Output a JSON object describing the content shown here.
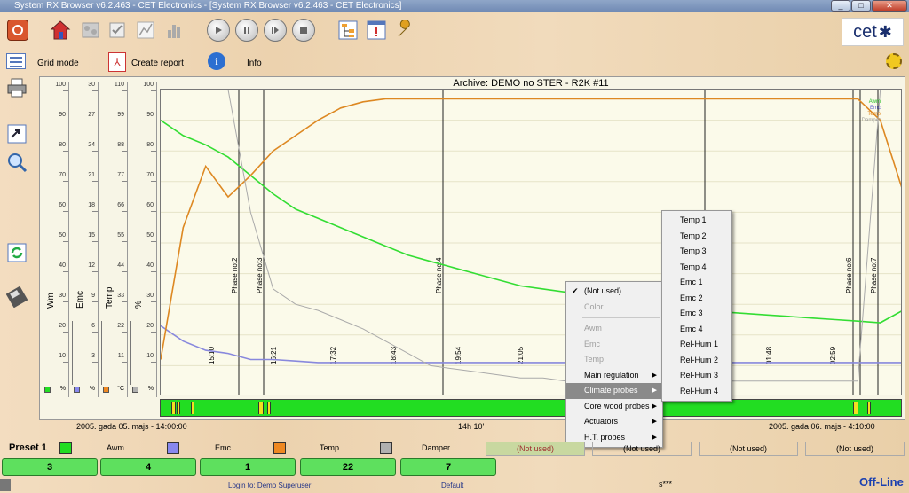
{
  "window": {
    "title": "System RX Browser v6.2.463 - CET Electronics - [System RX Browser v6.2.463 - CET Electronics]",
    "min": "_",
    "max": "□",
    "close": "✕"
  },
  "brand": {
    "logo_text": "cet"
  },
  "menu": {
    "grid_mode": "Grid mode",
    "create_report": "Create report",
    "info": "Info"
  },
  "chart": {
    "title": "Archive: DEMO no STER  -  R2K #11",
    "date_left": "2005. gada 05. majs  -  14:00:00",
    "duration": "14h 10'",
    "date_right": "2005. gada 06. majs  -  4:10:00",
    "time_ticks": [
      "15:10",
      "16:21",
      "17:32",
      "18:43",
      "19:54",
      "21:05",
      "01:48",
      "02:59"
    ],
    "phase_labels": [
      "Phase no:2",
      "Phase no:3",
      "Phase no:4",
      "Phase no:6",
      "Phase no:7"
    ],
    "right_legend": [
      "Awm",
      "Emc",
      "Temp",
      "Damper"
    ]
  },
  "axes": [
    {
      "name": "Wm",
      "unit": "%",
      "ticks": [
        "100",
        "90",
        "80",
        "70",
        "60",
        "50",
        "40",
        "30",
        "20",
        "10"
      ]
    },
    {
      "name": "Emc",
      "unit": "%",
      "ticks": [
        "30",
        "27",
        "24",
        "21",
        "18",
        "15",
        "12",
        "9",
        "6",
        "3"
      ]
    },
    {
      "name": "Temp",
      "unit": "°C",
      "ticks": [
        "110",
        "99",
        "88",
        "77",
        "66",
        "55",
        "44",
        "33",
        "22",
        "11"
      ]
    },
    {
      "name": "%",
      "unit": "%",
      "ticks": [
        "100",
        "90",
        "80",
        "70",
        "60",
        "50",
        "40",
        "30",
        "20",
        "10"
      ]
    }
  ],
  "context_menu": {
    "items": [
      {
        "label": "(Not used)",
        "checked": true,
        "disabled": false,
        "submenu": false
      },
      {
        "label": "Color...",
        "checked": false,
        "disabled": true,
        "submenu": false
      },
      {
        "separator": true
      },
      {
        "label": "Awm",
        "checked": false,
        "disabled": true,
        "submenu": false
      },
      {
        "label": "Emc",
        "checked": false,
        "disabled": true,
        "submenu": false
      },
      {
        "label": "Temp",
        "checked": false,
        "disabled": true,
        "submenu": false
      },
      {
        "label": "Main regulation",
        "checked": false,
        "disabled": false,
        "submenu": true
      },
      {
        "label": "Climate probes",
        "checked": false,
        "disabled": false,
        "submenu": true,
        "selected": true
      },
      {
        "label": "Core wood probes",
        "checked": false,
        "disabled": false,
        "submenu": true
      },
      {
        "label": "Actuators",
        "checked": false,
        "disabled": false,
        "submenu": true
      },
      {
        "label": "H.T. probes",
        "checked": false,
        "disabled": false,
        "submenu": true
      }
    ],
    "submenu": [
      "Temp 1",
      "Temp 2",
      "Temp 3",
      "Temp 4",
      "Emc 1",
      "Emc 2",
      "Emc 3",
      "Emc 4",
      "Rel-Hum 1",
      "Rel-Hum 2",
      "Rel-Hum 3",
      "Rel-Hum 4"
    ]
  },
  "preset": {
    "label": "Preset 1",
    "legend": [
      {
        "name": "Awm",
        "color": "#22dd22"
      },
      {
        "name": "Emc",
        "color": "#8888ee"
      },
      {
        "name": "Temp",
        "color": "#ee8822"
      },
      {
        "name": "Damper",
        "color": "#b0b0b0"
      }
    ],
    "not_used": [
      "(Not used)",
      "(Not used)",
      "(Not used)",
      "(Not used)"
    ],
    "buttons": [
      "3",
      "4",
      "1",
      "22",
      "7"
    ]
  },
  "footer": {
    "login": "Login to: Demo Superuser",
    "profile": "Default",
    "code": "s***",
    "status": "Off-Line"
  },
  "chart_data": {
    "type": "line",
    "x_label": "time",
    "series": [
      {
        "name": "Awm",
        "color": "#33dd33",
        "values": [
          90,
          85,
          82,
          78,
          72,
          66,
          61,
          58,
          55,
          52,
          49,
          46,
          44,
          42,
          40,
          38,
          36,
          35,
          34,
          33,
          32,
          31,
          30,
          29,
          28,
          27.5,
          27,
          26.5,
          26,
          25.5,
          25,
          24.5,
          24,
          28
        ]
      },
      {
        "name": "Emc",
        "color": "#8888dd",
        "values": [
          23,
          18,
          15,
          14,
          12,
          12,
          11.5,
          11,
          11,
          11,
          11,
          11,
          11,
          11,
          11,
          11,
          11,
          11,
          11,
          11,
          11,
          11,
          11,
          11,
          11,
          11,
          11,
          11,
          11,
          11,
          11,
          11,
          11,
          11
        ]
      },
      {
        "name": "Temp",
        "color": "#dd8822",
        "values": [
          12,
          55,
          75,
          65,
          72,
          80,
          85,
          90,
          94,
          96,
          97,
          97,
          97,
          97,
          97,
          97,
          97,
          97,
          97,
          97,
          97,
          97,
          97,
          97,
          97,
          97,
          97,
          97,
          97,
          97,
          97,
          97,
          90,
          67
        ]
      },
      {
        "name": "Damper",
        "color": "#aaaaaa",
        "values": [
          100,
          100,
          100,
          100,
          60,
          35,
          30,
          28,
          25,
          22,
          18,
          14,
          10,
          9,
          8,
          7,
          6,
          6,
          5,
          5,
          5,
          5,
          5,
          5,
          5,
          5,
          5,
          5,
          5,
          5,
          5,
          5,
          100,
          100
        ]
      }
    ]
  }
}
